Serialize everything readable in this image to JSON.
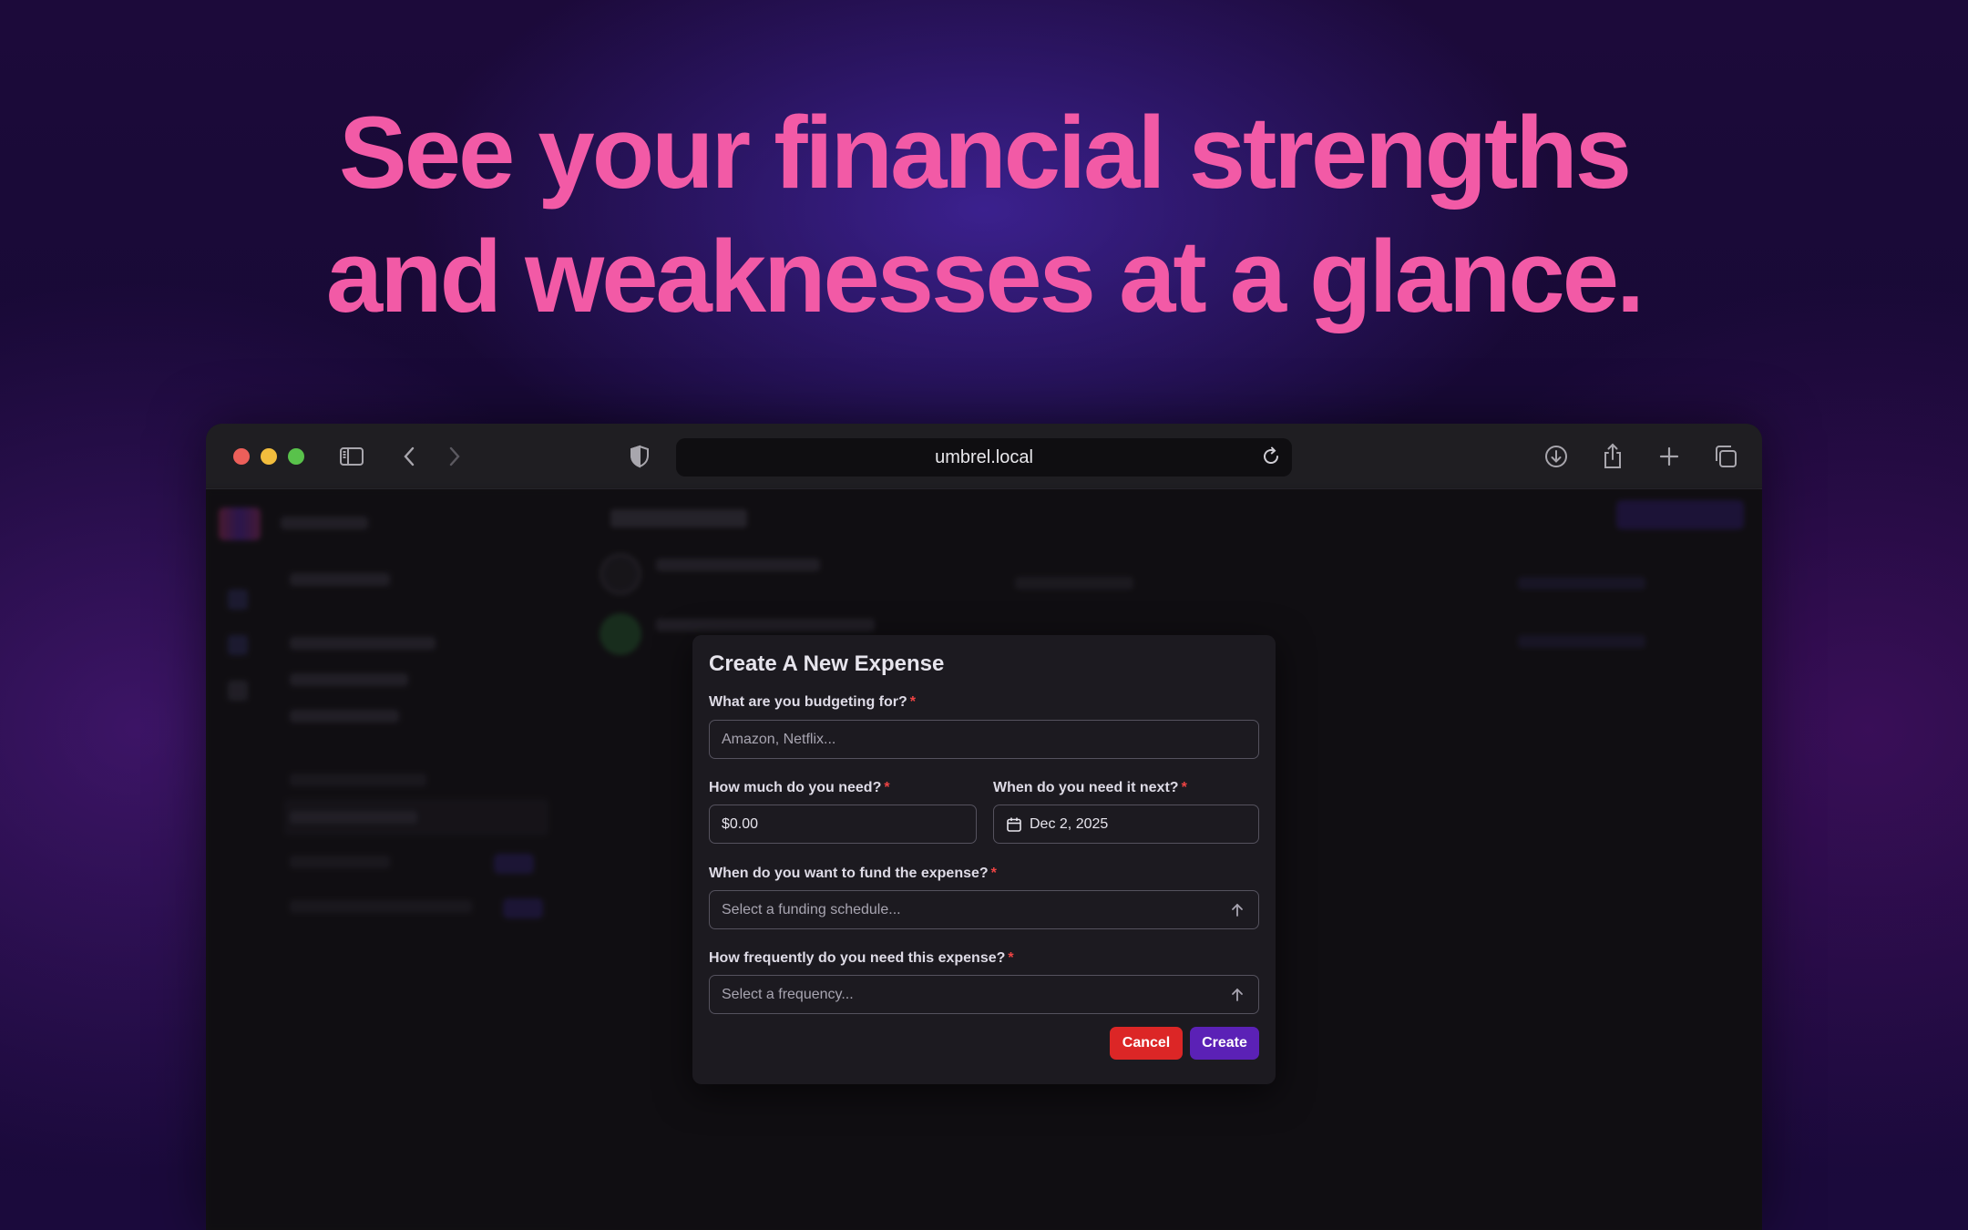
{
  "headline": {
    "line1": "See your financial strengths",
    "line2": "and weaknesses at a glance."
  },
  "browser": {
    "url": "umbrel.local",
    "icons": [
      "sidebar-toggle-icon",
      "back-icon",
      "forward-icon",
      "privacy-shield-icon",
      "download-icon",
      "share-icon",
      "new-tab-icon",
      "tab-overview-icon",
      "reload-icon"
    ]
  },
  "colors": {
    "headline": "#f25aa6",
    "cancel": "#dc2626",
    "create": "#5b21b6",
    "required": "#ef4444"
  },
  "modal": {
    "title": "Create A New Expense",
    "name_label": "What are you budgeting for?",
    "name_placeholder": "Amazon, Netflix...",
    "amount_label": "How much do you need?",
    "amount_value": "$0.00",
    "date_label": "When do you need it next?",
    "date_value": "Dec 2, 2025",
    "funding_label": "When do you want to fund the expense?",
    "funding_placeholder": "Select a funding schedule...",
    "frequency_label": "How frequently do you need this expense?",
    "frequency_placeholder": "Select a frequency...",
    "required_marker": "*",
    "cancel_label": "Cancel",
    "create_label": "Create"
  }
}
